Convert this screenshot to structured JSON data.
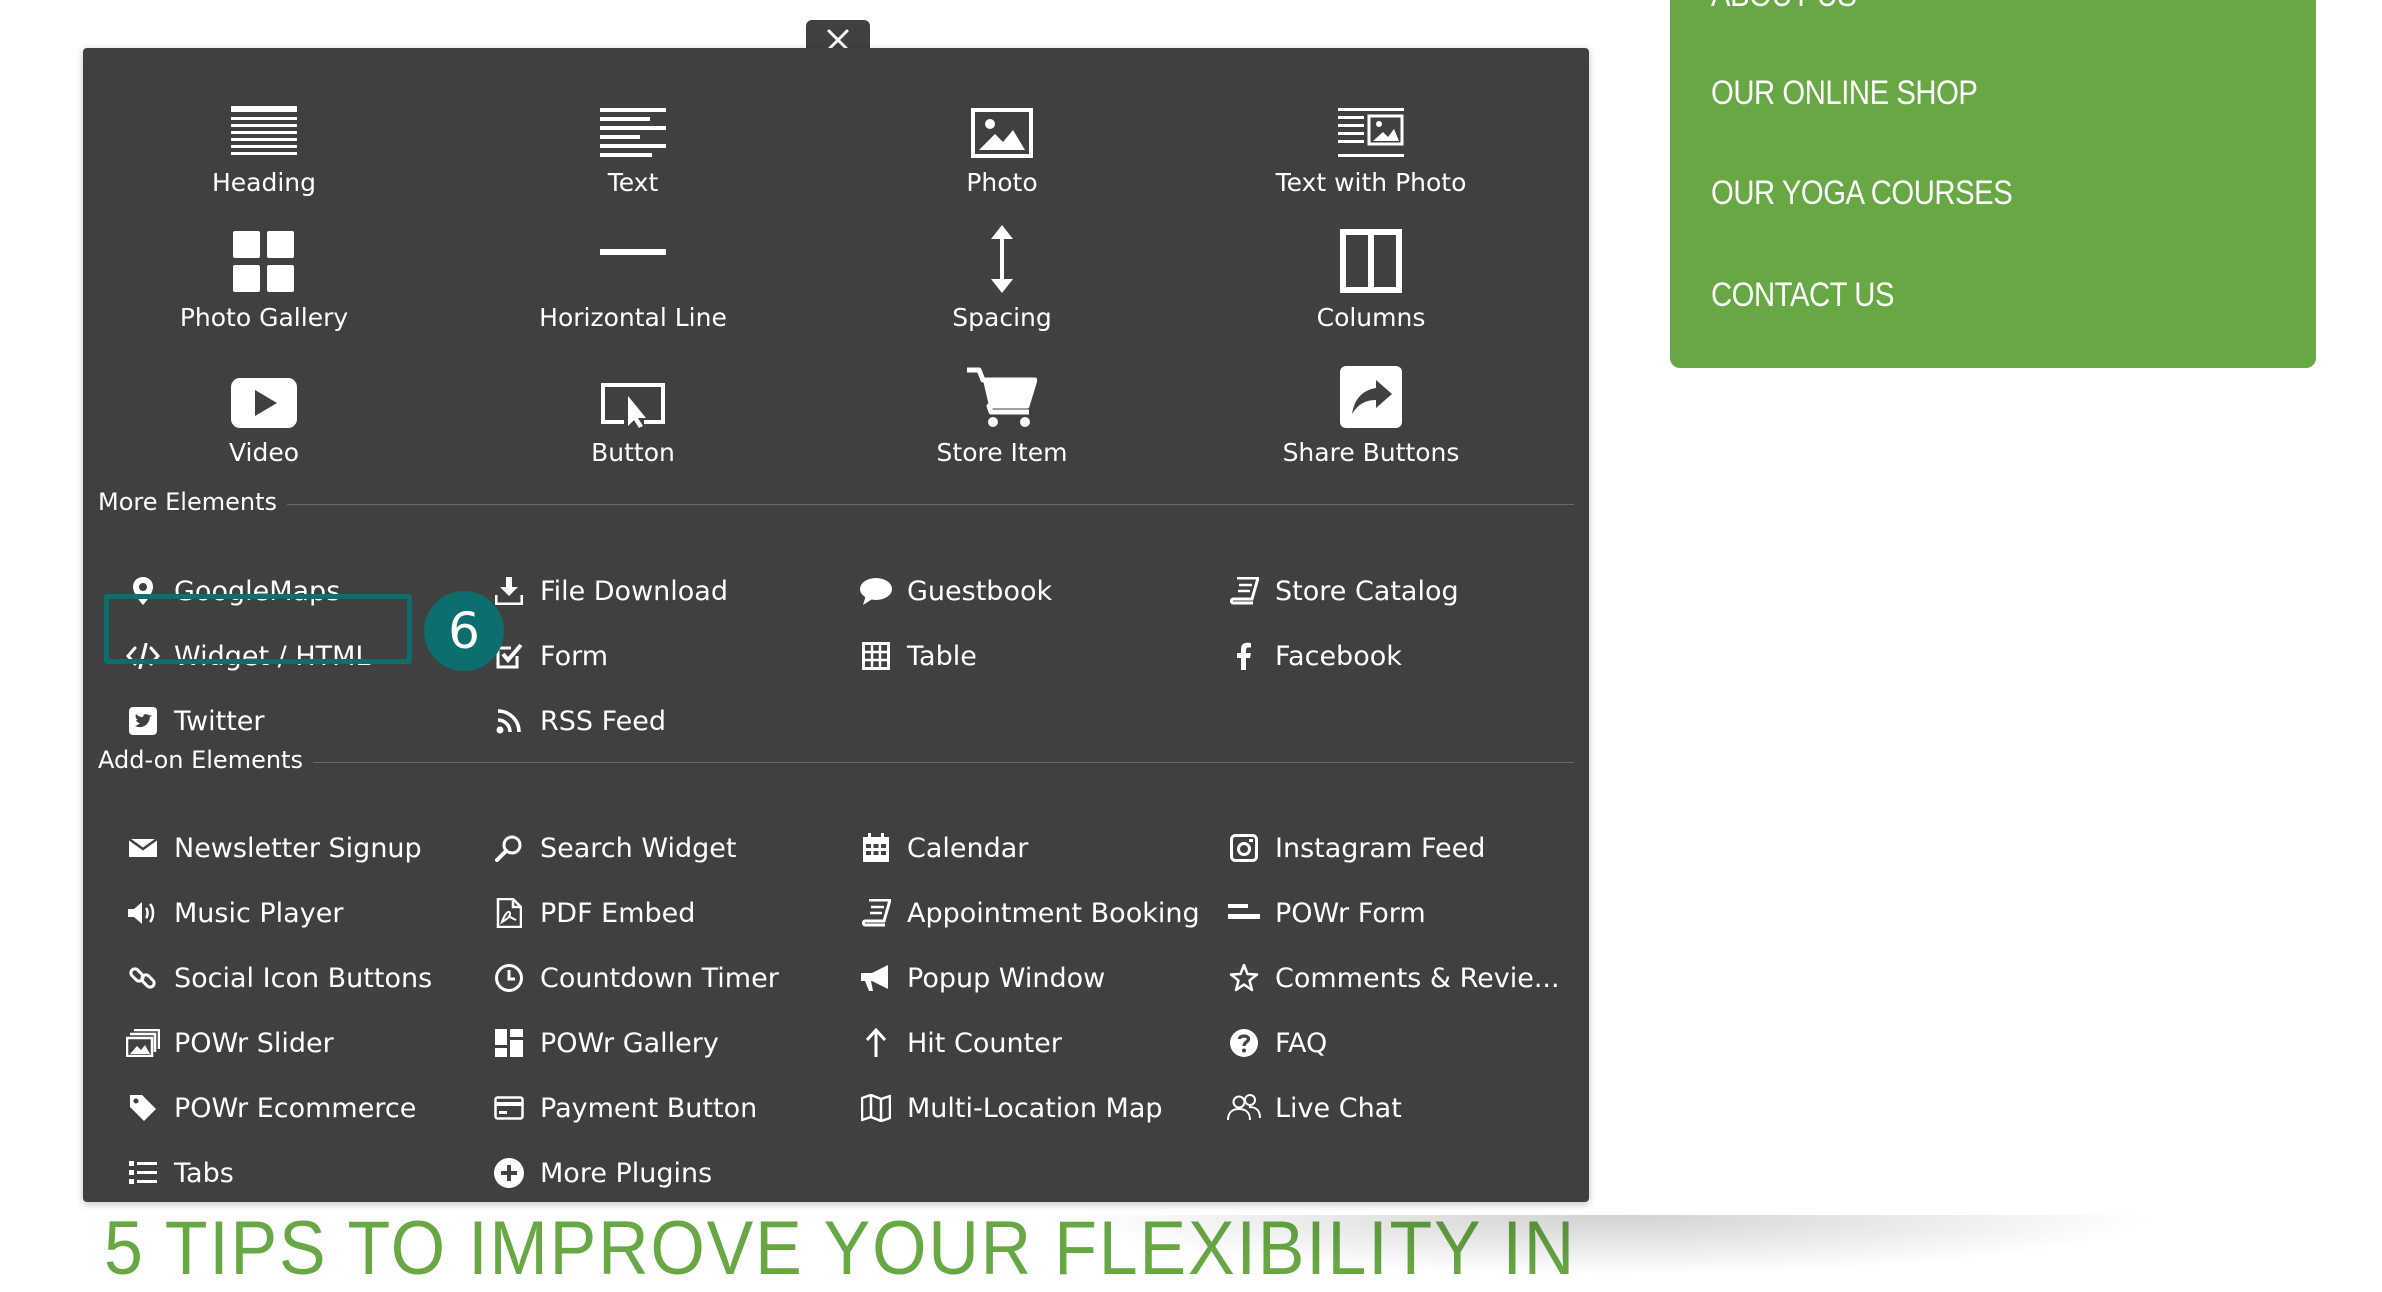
{
  "side_nav": {
    "items": [
      {
        "label": "ABOUT US"
      },
      {
        "label": "OUR ONLINE SHOP"
      },
      {
        "label": "OUR YOGA COURSES"
      },
      {
        "label": "CONTACT US"
      }
    ]
  },
  "page_heading": "5 TIPS TO IMPROVE YOUR FLEXIBILITY IN",
  "panel": {
    "close_icon": "close-icon",
    "tiles": [
      {
        "label": "Heading",
        "icon": "heading-icon"
      },
      {
        "label": "Text",
        "icon": "text-icon"
      },
      {
        "label": "Photo",
        "icon": "photo-icon"
      },
      {
        "label": "Text with Photo",
        "icon": "text-with-photo-icon"
      },
      {
        "label": "Photo Gallery",
        "icon": "photo-gallery-icon"
      },
      {
        "label": "Horizontal Line",
        "icon": "horizontal-line-icon"
      },
      {
        "label": "Spacing",
        "icon": "spacing-icon"
      },
      {
        "label": "Columns",
        "icon": "columns-icon"
      },
      {
        "label": "Video",
        "icon": "video-icon"
      },
      {
        "label": "Button",
        "icon": "button-icon"
      },
      {
        "label": "Store Item",
        "icon": "cart-icon"
      },
      {
        "label": "Share Buttons",
        "icon": "share-icon"
      }
    ],
    "more_title": "More Elements",
    "more_items": [
      {
        "label": "GoogleMaps",
        "icon": "map-pin-icon"
      },
      {
        "label": "File Download",
        "icon": "download-icon"
      },
      {
        "label": "Guestbook",
        "icon": "speech-bubble-icon"
      },
      {
        "label": "Store Catalog",
        "icon": "book-icon"
      },
      {
        "label": "Widget / HTML",
        "icon": "code-icon"
      },
      {
        "label": "Form",
        "icon": "checkbox-icon"
      },
      {
        "label": "Table",
        "icon": "table-icon"
      },
      {
        "label": "Facebook",
        "icon": "facebook-icon"
      },
      {
        "label": "Twitter",
        "icon": "twitter-icon"
      },
      {
        "label": "RSS Feed",
        "icon": "rss-icon"
      }
    ],
    "addon_title": "Add-on Elements",
    "addon_items": [
      {
        "label": "Newsletter Signup",
        "icon": "envelope-icon"
      },
      {
        "label": "Search Widget",
        "icon": "search-icon"
      },
      {
        "label": "Calendar",
        "icon": "calendar-icon"
      },
      {
        "label": "Instagram Feed",
        "icon": "instagram-icon"
      },
      {
        "label": "Music Player",
        "icon": "speaker-icon"
      },
      {
        "label": "PDF Embed",
        "icon": "pdf-icon"
      },
      {
        "label": "Appointment Booking",
        "icon": "book-icon"
      },
      {
        "label": "POWr Form",
        "icon": "form-lines-icon"
      },
      {
        "label": "Social Icon Buttons",
        "icon": "link-icon"
      },
      {
        "label": "Countdown Timer",
        "icon": "clock-icon"
      },
      {
        "label": "Popup Window",
        "icon": "megaphone-icon"
      },
      {
        "label": "Comments & Revie...",
        "icon": "star-icon"
      },
      {
        "label": "POWr Slider",
        "icon": "slider-icon"
      },
      {
        "label": "POWr Gallery",
        "icon": "gallery-grid-icon"
      },
      {
        "label": "Hit Counter",
        "icon": "arrow-up-icon"
      },
      {
        "label": "FAQ",
        "icon": "question-icon"
      },
      {
        "label": "POWr Ecommerce",
        "icon": "tag-icon"
      },
      {
        "label": "Payment Button",
        "icon": "credit-card-icon"
      },
      {
        "label": "Multi-Location Map",
        "icon": "map-icon"
      },
      {
        "label": "Live Chat",
        "icon": "users-icon"
      },
      {
        "label": "Tabs",
        "icon": "list-icon"
      },
      {
        "label": "More Plugins",
        "icon": "plus-circle-icon"
      }
    ]
  },
  "step_badge": "6",
  "colors": {
    "panel_bg": "#404040",
    "brand_green": "#67a844",
    "highlight_teal": "#0d6e6e"
  }
}
